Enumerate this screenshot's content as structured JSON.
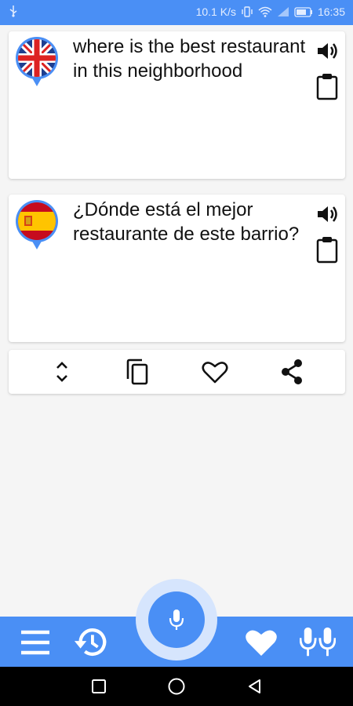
{
  "status_bar": {
    "usb_icon": "usb-icon",
    "speed": "10.1 K/s",
    "time": "16:35",
    "icons": [
      "vibrate-icon",
      "wifi-icon",
      "signal-icon",
      "battery-icon"
    ]
  },
  "translation": {
    "source": {
      "flag": "uk-flag-icon",
      "text": "where is the best restaurant in this neighborhood"
    },
    "target": {
      "flag": "spain-flag-icon",
      "text": "¿Dónde está el mejor restaurante de este barrio?"
    }
  },
  "actions": [
    "swap-icon",
    "copy-icon",
    "favorite-icon",
    "share-icon"
  ],
  "bottom_nav": [
    "menu-icon",
    "history-icon",
    "mic-icon",
    "favorites-icon",
    "conversation-icon"
  ],
  "system_nav": [
    "recent-apps-icon",
    "home-icon",
    "back-icon"
  ],
  "colors": {
    "primary": "#4a8ff5",
    "mic_ring": "#d6e5fd"
  }
}
